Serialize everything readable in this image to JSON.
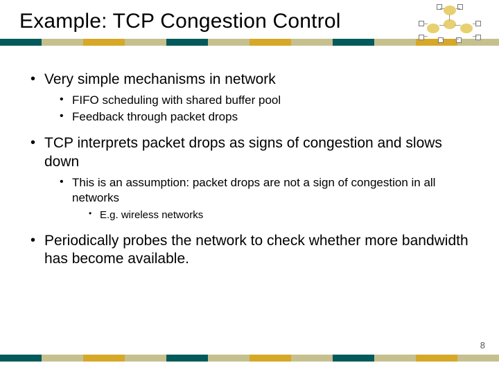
{
  "title": "Example: TCP Congestion Control",
  "page_number": "8",
  "stripe_colors": [
    "#025a5a",
    "#c6c08e",
    "#d6a828",
    "#c6c08e",
    "#025a5a",
    "#c6c08e",
    "#d6a828",
    "#c6c08e",
    "#025a5a",
    "#c6c08e",
    "#d6a828",
    "#c6c08e"
  ],
  "bullets": [
    {
      "text": "Very simple mechanisms in network",
      "children": [
        {
          "text": "FIFO scheduling with shared buffer pool"
        },
        {
          "text": "Feedback through packet drops"
        }
      ]
    },
    {
      "text": "TCP interprets packet drops as signs of congestion and slows down",
      "children": [
        {
          "text": "This is an assumption: packet drops are not a sign of congestion in all networks",
          "children": [
            {
              "text": "E.g. wireless networks"
            }
          ]
        }
      ]
    },
    {
      "text": "Periodically probes the network to check whether more bandwidth has become available."
    }
  ]
}
